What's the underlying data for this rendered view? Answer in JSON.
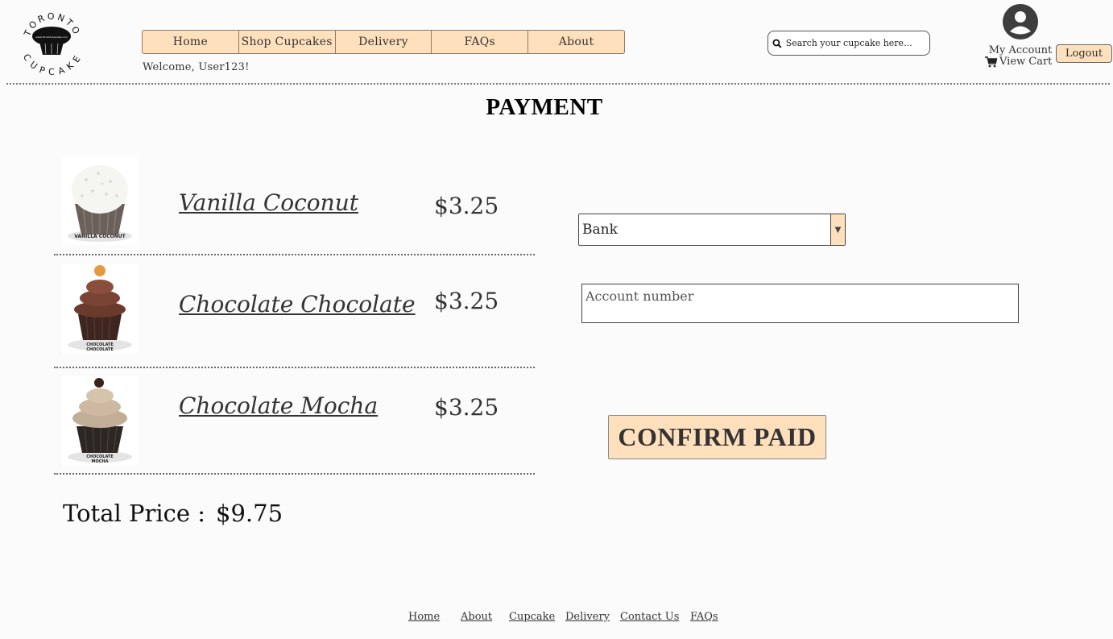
{
  "brand": {
    "logo_text_top": "TORONTO",
    "logo_text_bottom": "CUPCAKE",
    "logo_url_text": "www.TorontoCupcake.com"
  },
  "nav": {
    "items": [
      {
        "label": "Home"
      },
      {
        "label": "Shop Cupcakes"
      },
      {
        "label": "Delivery"
      },
      {
        "label": "FAQs"
      },
      {
        "label": "About"
      }
    ],
    "accent": "#ffe0bd"
  },
  "header": {
    "welcome": "Welcome, User123!",
    "search_placeholder": "Search your cupcake here...",
    "account_label": "My Account",
    "cart_label": "View Cart",
    "logout_label": "Logout"
  },
  "page": {
    "title": "PAYMENT"
  },
  "cart": {
    "items": [
      {
        "name": "Vanilla Coconut",
        "price": "$3.25",
        "image_caption": "VANILLA COCONUT"
      },
      {
        "name": "Chocolate Chocolate",
        "price": "$3.25",
        "image_caption_1": "CHOCOLATE",
        "image_caption_2": "CHOCOLATE"
      },
      {
        "name": "Chocolate Mocha",
        "price": "$3.25",
        "image_caption_1": "CHOCOLATE",
        "image_caption_2": "MOCHA"
      }
    ],
    "total_label": "Total Price :",
    "total_value": "$9.75"
  },
  "payment": {
    "method_selected": "Bank",
    "account_placeholder": "Account number",
    "confirm_label": "CONFIRM PAID"
  },
  "footer": {
    "links": [
      {
        "label": "Home"
      },
      {
        "label": "About"
      },
      {
        "label": "Cupcake"
      },
      {
        "label": "Delivery"
      },
      {
        "label": "Contact Us"
      },
      {
        "label": "FAQs"
      }
    ]
  }
}
